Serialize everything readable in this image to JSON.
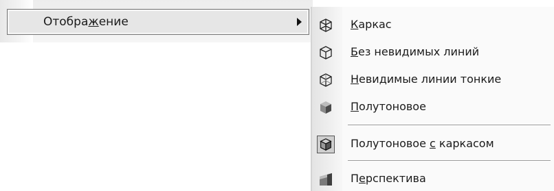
{
  "parent_menu": {
    "item": {
      "label_pre": "Отобра",
      "label_u": "ж",
      "label_post": "ение"
    }
  },
  "submenu": {
    "items": [
      {
        "icon": "wireframe-cube-icon",
        "u": "К",
        "post": "аркас"
      },
      {
        "icon": "hidden-lines-removed-cube-icon",
        "u": "Б",
        "post": "ез невидимых линий"
      },
      {
        "icon": "thin-hidden-lines-cube-icon",
        "u": "Н",
        "post": "евидимые линии тонкие"
      },
      {
        "icon": "shaded-cube-icon",
        "u": "П",
        "post": "олутоновое"
      },
      {
        "icon": "shaded-wireframe-cube-icon",
        "pre": "Полутоновое ",
        "u": "с",
        "post": " каркасом"
      },
      {
        "icon": "perspective-icon",
        "pre": "П",
        "u": "е",
        "post": "рспектива"
      }
    ]
  }
}
